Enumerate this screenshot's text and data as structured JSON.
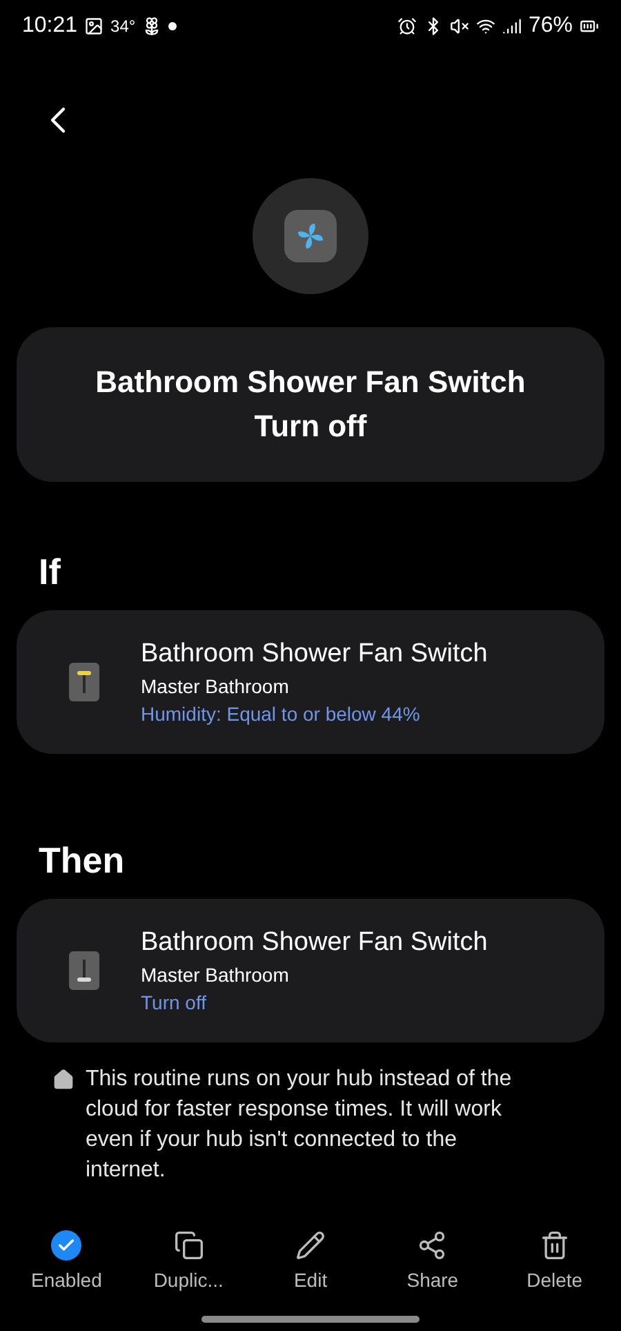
{
  "status_bar": {
    "time": "10:21",
    "temperature": "34°",
    "battery": "76%"
  },
  "header": {
    "title_lines": [
      "Bathroom Shower Fan Switch",
      "Turn off"
    ]
  },
  "sections": [
    {
      "heading": "If",
      "device": {
        "name": "Bathroom Shower Fan Switch",
        "room": "Master Bathroom",
        "detail": "Humidity: Equal to or below 44%",
        "on": true
      }
    },
    {
      "heading": "Then",
      "device": {
        "name": "Bathroom Shower Fan Switch",
        "room": "Master Bathroom",
        "detail": "Turn off",
        "on": false
      }
    }
  ],
  "note": "This routine runs on your hub instead of the cloud for faster response times. It will work even if your hub isn't connected to the internet.",
  "toolbar": [
    {
      "kind": "enabled",
      "label": "Enabled",
      "checked": true
    },
    {
      "kind": "duplicate",
      "label": "Duplic..."
    },
    {
      "kind": "edit",
      "label": "Edit"
    },
    {
      "kind": "share",
      "label": "Share"
    },
    {
      "kind": "delete",
      "label": "Delete"
    }
  ]
}
